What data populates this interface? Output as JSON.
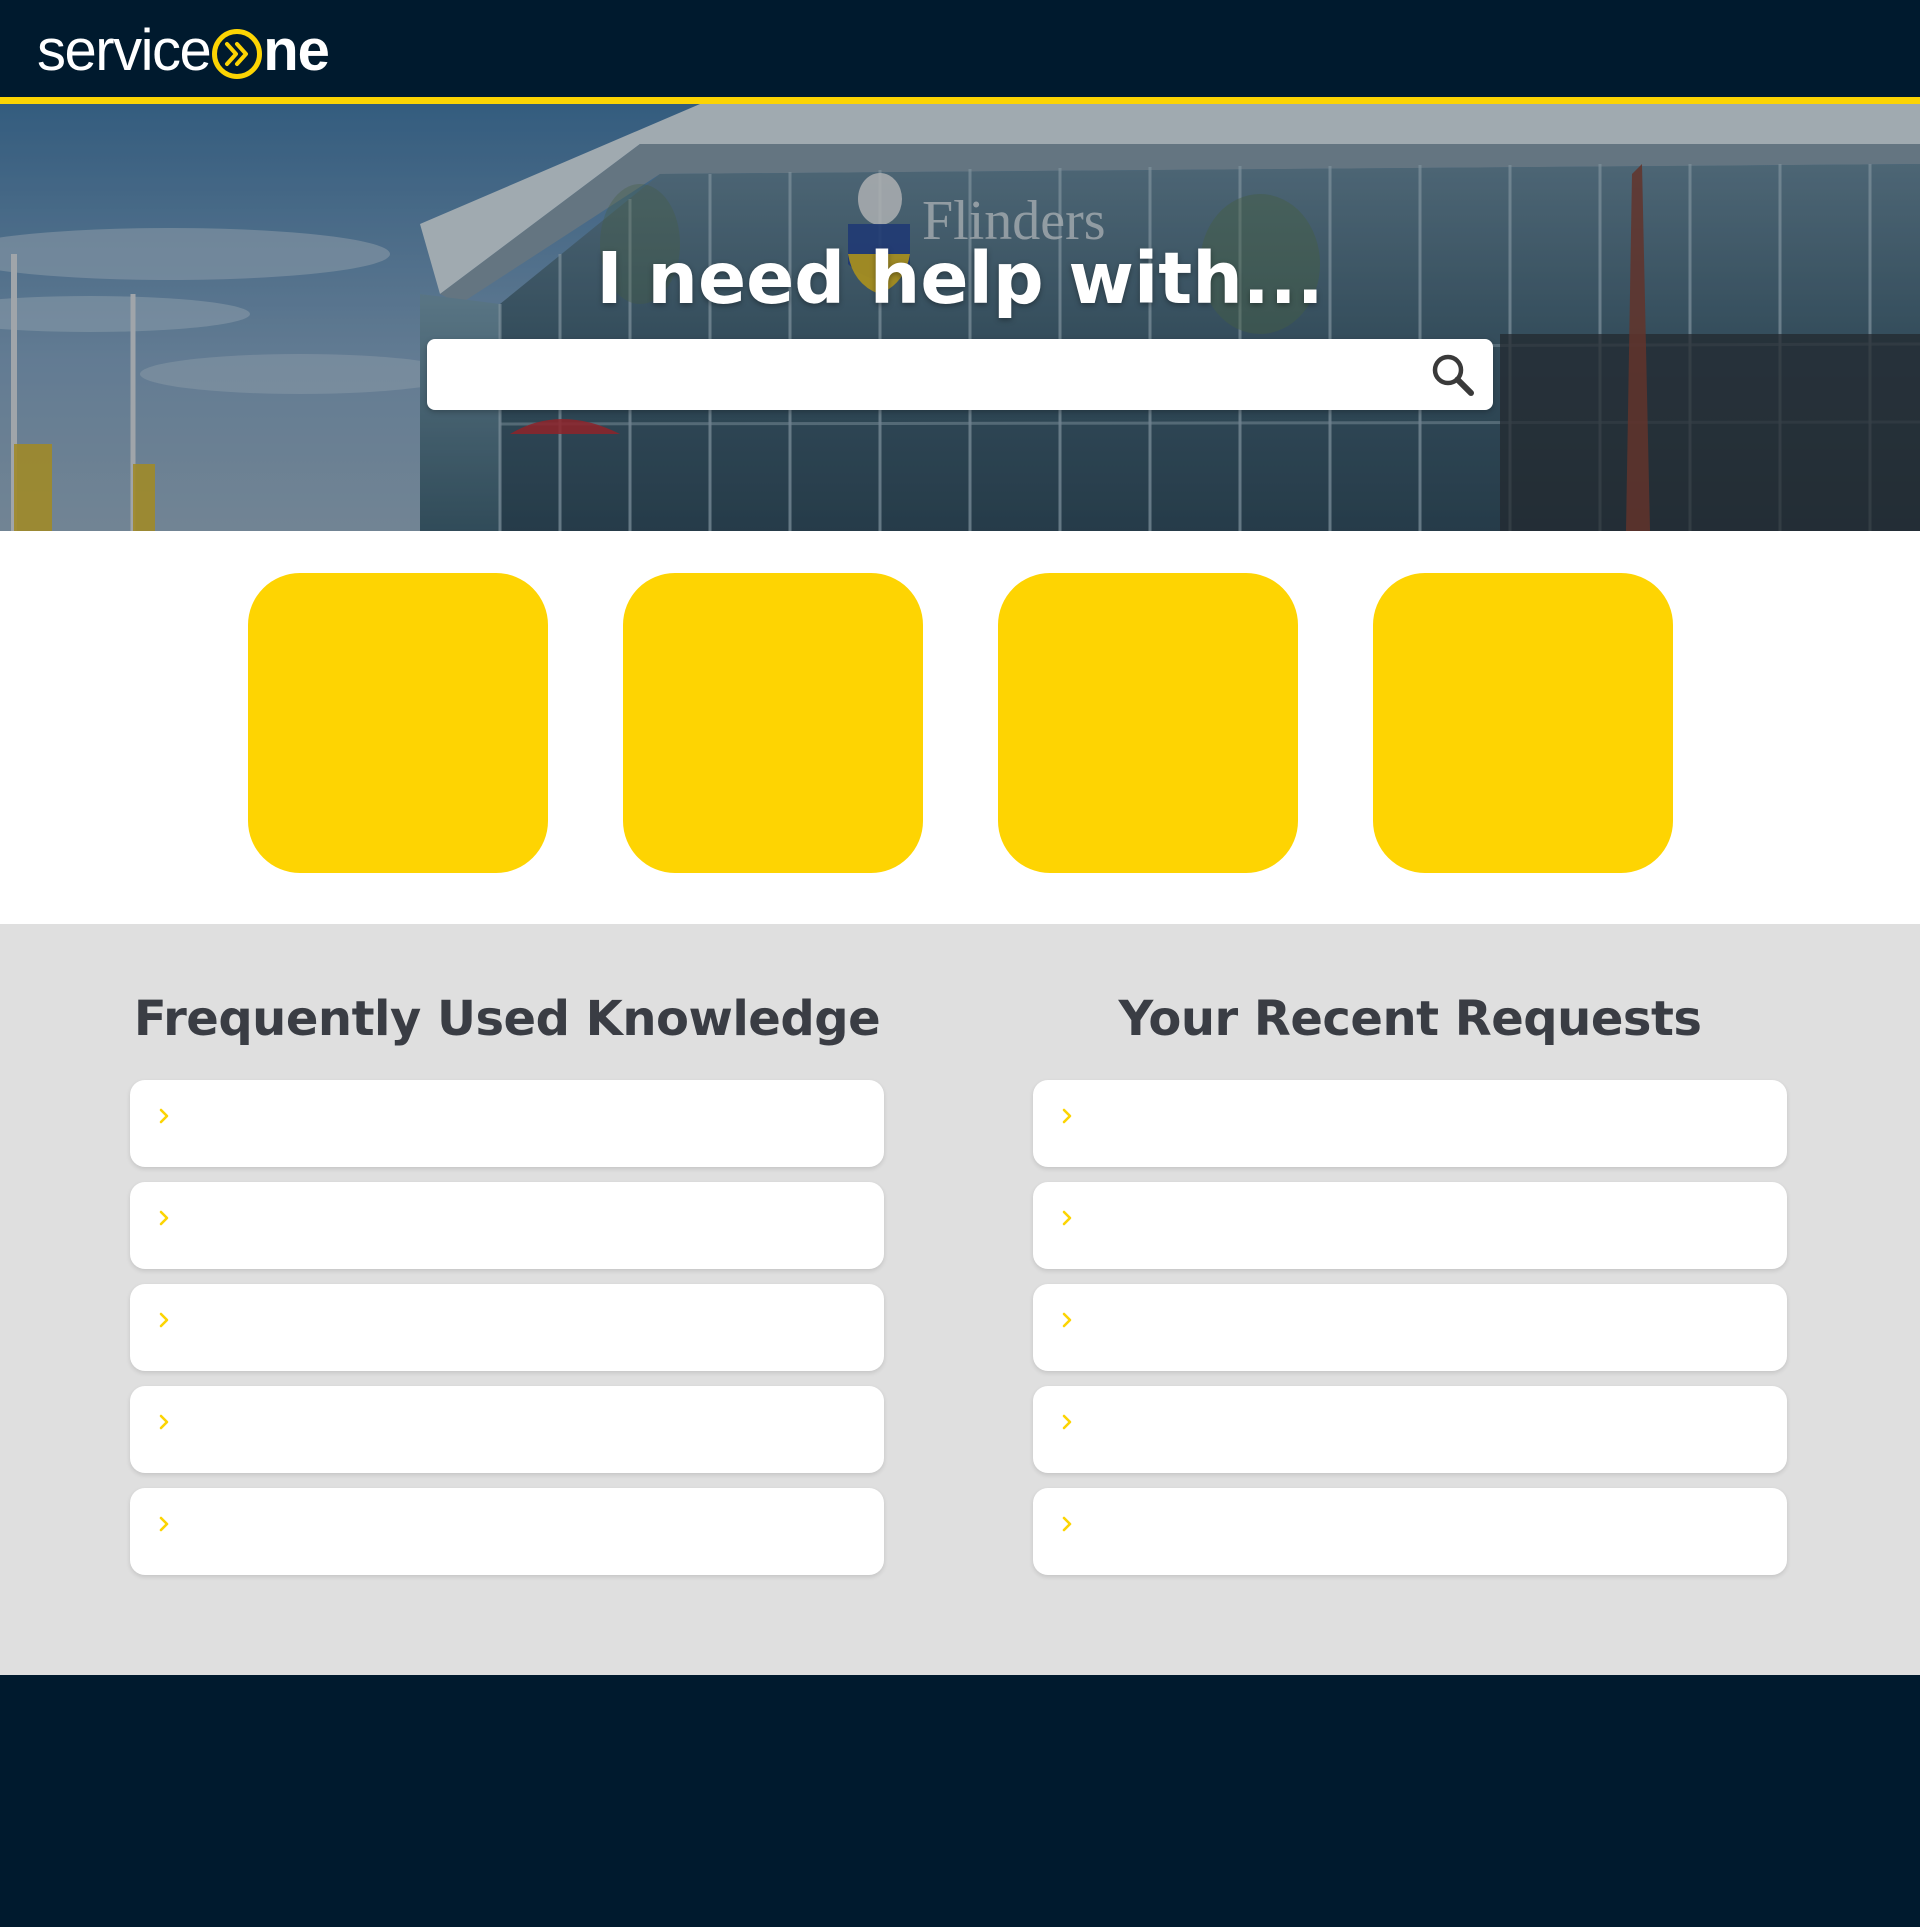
{
  "brand": {
    "name_part1": "service",
    "name_part2": "ne",
    "logo_mark_icon": "double-chevron-circle-icon",
    "accent_color": "#fcd403",
    "navy_color": "#001a2e"
  },
  "hero": {
    "title": "I need help with...",
    "background_image": "flinders-building-photo",
    "building_sign_text": "Flinders",
    "search": {
      "value": "",
      "placeholder": "",
      "button_icon": "search-icon"
    }
  },
  "tiles": [
    {
      "label": ""
    },
    {
      "label": ""
    },
    {
      "label": ""
    },
    {
      "label": ""
    }
  ],
  "knowledge": {
    "title": "Frequently Used Knowledge",
    "items": [
      {
        "label": "",
        "icon": "chevron-right-icon"
      },
      {
        "label": "",
        "icon": "chevron-right-icon"
      },
      {
        "label": "",
        "icon": "chevron-right-icon"
      },
      {
        "label": "",
        "icon": "chevron-right-icon"
      },
      {
        "label": "",
        "icon": "chevron-right-icon"
      }
    ]
  },
  "requests": {
    "title": "Your Recent Requests",
    "items": [
      {
        "label": "",
        "icon": "chevron-right-icon"
      },
      {
        "label": "",
        "icon": "chevron-right-icon"
      },
      {
        "label": "",
        "icon": "chevron-right-icon"
      },
      {
        "label": "",
        "icon": "chevron-right-icon"
      },
      {
        "label": "",
        "icon": "chevron-right-icon"
      }
    ]
  }
}
